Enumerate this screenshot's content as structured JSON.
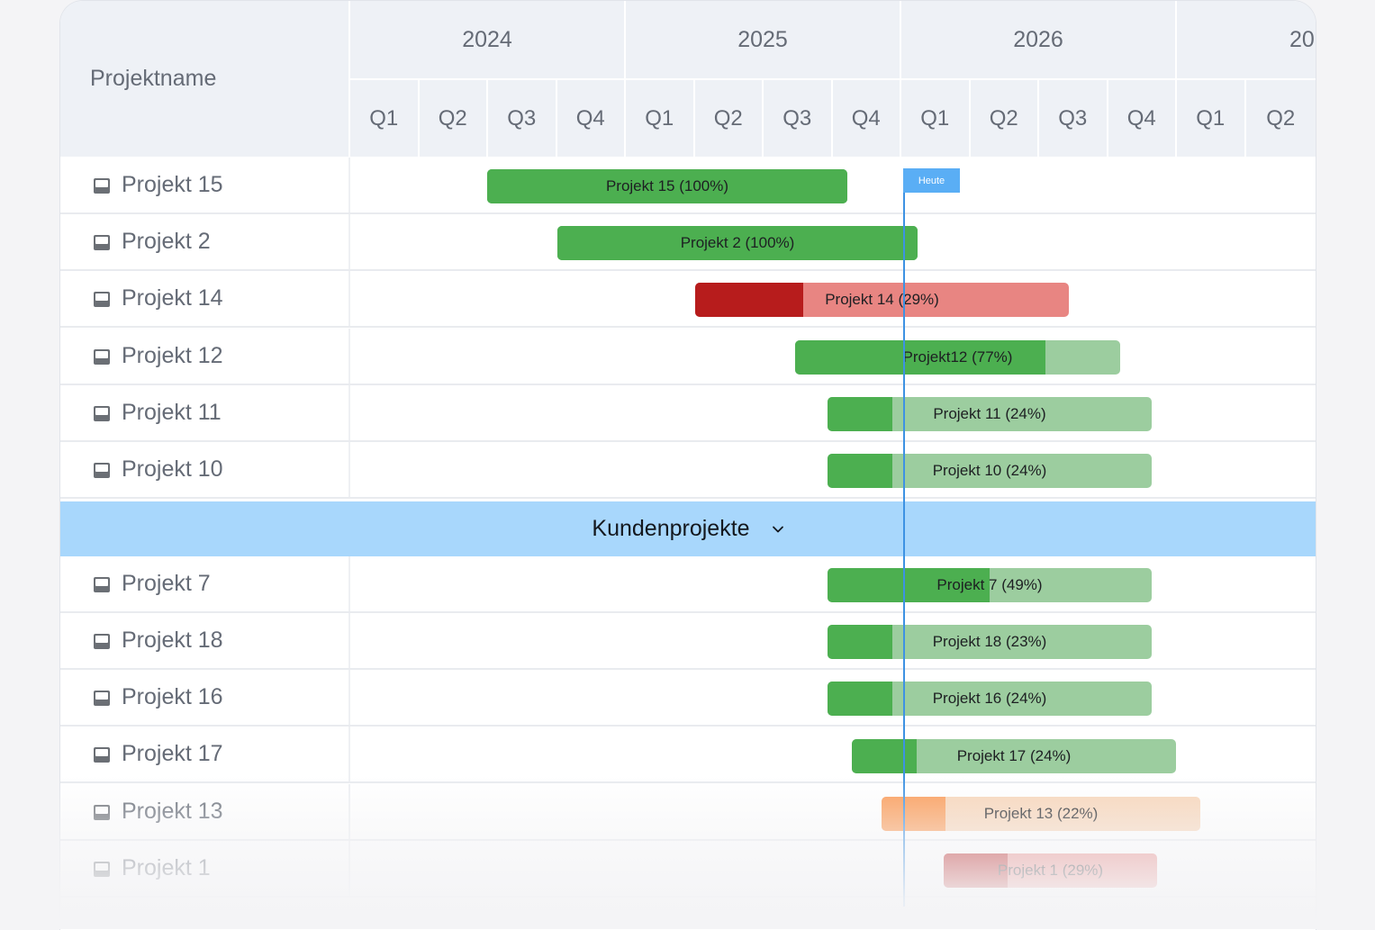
{
  "header": {
    "name_column_label": "Projektname",
    "years": [
      "2024",
      "2025",
      "2026",
      "20"
    ],
    "quarters": [
      "Q1",
      "Q2",
      "Q3",
      "Q4",
      "Q1",
      "Q2",
      "Q3",
      "Q4",
      "Q1",
      "Q2",
      "Q3",
      "Q4",
      "Q1",
      "Q2"
    ]
  },
  "today": {
    "label": "Heute"
  },
  "colors": {
    "green": "#4caf50",
    "green_light": "#9ccd9f",
    "red": "#b71c1c",
    "red_light": "#e88582",
    "orange": "#fb9a55",
    "orange_light": "#f8d5b8",
    "today_line": "#3d92e3",
    "group_band": "#a8d7fc"
  },
  "projects": [
    {
      "name": "Projekt 15",
      "bar_label": "Projekt 15 (100%)",
      "progress": 1.0,
      "status": "green"
    },
    {
      "name": "Projekt 2",
      "bar_label": "Projekt 2 (100%)",
      "progress": 1.0,
      "status": "green"
    },
    {
      "name": "Projekt 14",
      "bar_label": "Projekt 14 (29%)",
      "progress": 0.29,
      "status": "red"
    },
    {
      "name": "Projekt 12",
      "bar_label": "Projekt12 (77%)",
      "progress": 0.77,
      "status": "green"
    },
    {
      "name": "Projekt 11",
      "bar_label": "Projekt 11 (24%)",
      "progress": 0.24,
      "status": "green"
    },
    {
      "name": "Projekt 10",
      "bar_label": "Projekt 10 (24%)",
      "progress": 0.24,
      "status": "green"
    }
  ],
  "group": {
    "label": "Kundenprojekte",
    "projects": [
      {
        "name": "Projekt 7",
        "bar_label": "Projekt 7 (49%)",
        "progress": 0.49,
        "status": "green"
      },
      {
        "name": "Projekt 18",
        "bar_label": "Projekt 18 (23%)",
        "progress": 0.23,
        "status": "green"
      },
      {
        "name": "Projekt 16",
        "bar_label": "Projekt 16 (24%)",
        "progress": 0.24,
        "status": "green"
      },
      {
        "name": "Projekt 17",
        "bar_label": "Projekt 17 (24%)",
        "progress": 0.24,
        "status": "green"
      },
      {
        "name": "Projekt 13",
        "bar_label": "Projekt 13 (22%)",
        "progress": 0.22,
        "status": "orange"
      },
      {
        "name": "Projekt 1",
        "bar_label": "Projekt 1 (29%)",
        "progress": 0.29,
        "status": "red"
      }
    ]
  }
}
